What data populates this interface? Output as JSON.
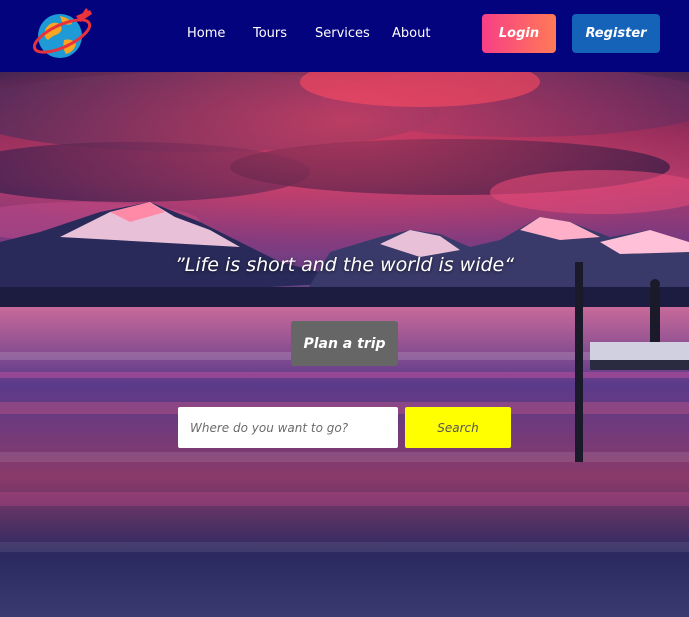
{
  "nav": {
    "links": [
      {
        "label": "Home"
      },
      {
        "label": "Tours"
      },
      {
        "label": "Services"
      },
      {
        "label": "About"
      }
    ],
    "login_label": "Login",
    "register_label": "Register"
  },
  "hero": {
    "quote": "”Life is short and the world is wide“",
    "plan_label": "Plan a trip",
    "search_placeholder": "Where do you want to go?",
    "search_label": "Search"
  },
  "colors": {
    "nav_bg": "#04037e",
    "login_gradient_start": "#f73f86",
    "login_gradient_end": "#ff7a57",
    "register_bg": "#1463b9",
    "plan_bg": "#666666",
    "search_bg": "#ffff00"
  },
  "icons": {
    "logo": "globe-plane-logo-icon"
  }
}
